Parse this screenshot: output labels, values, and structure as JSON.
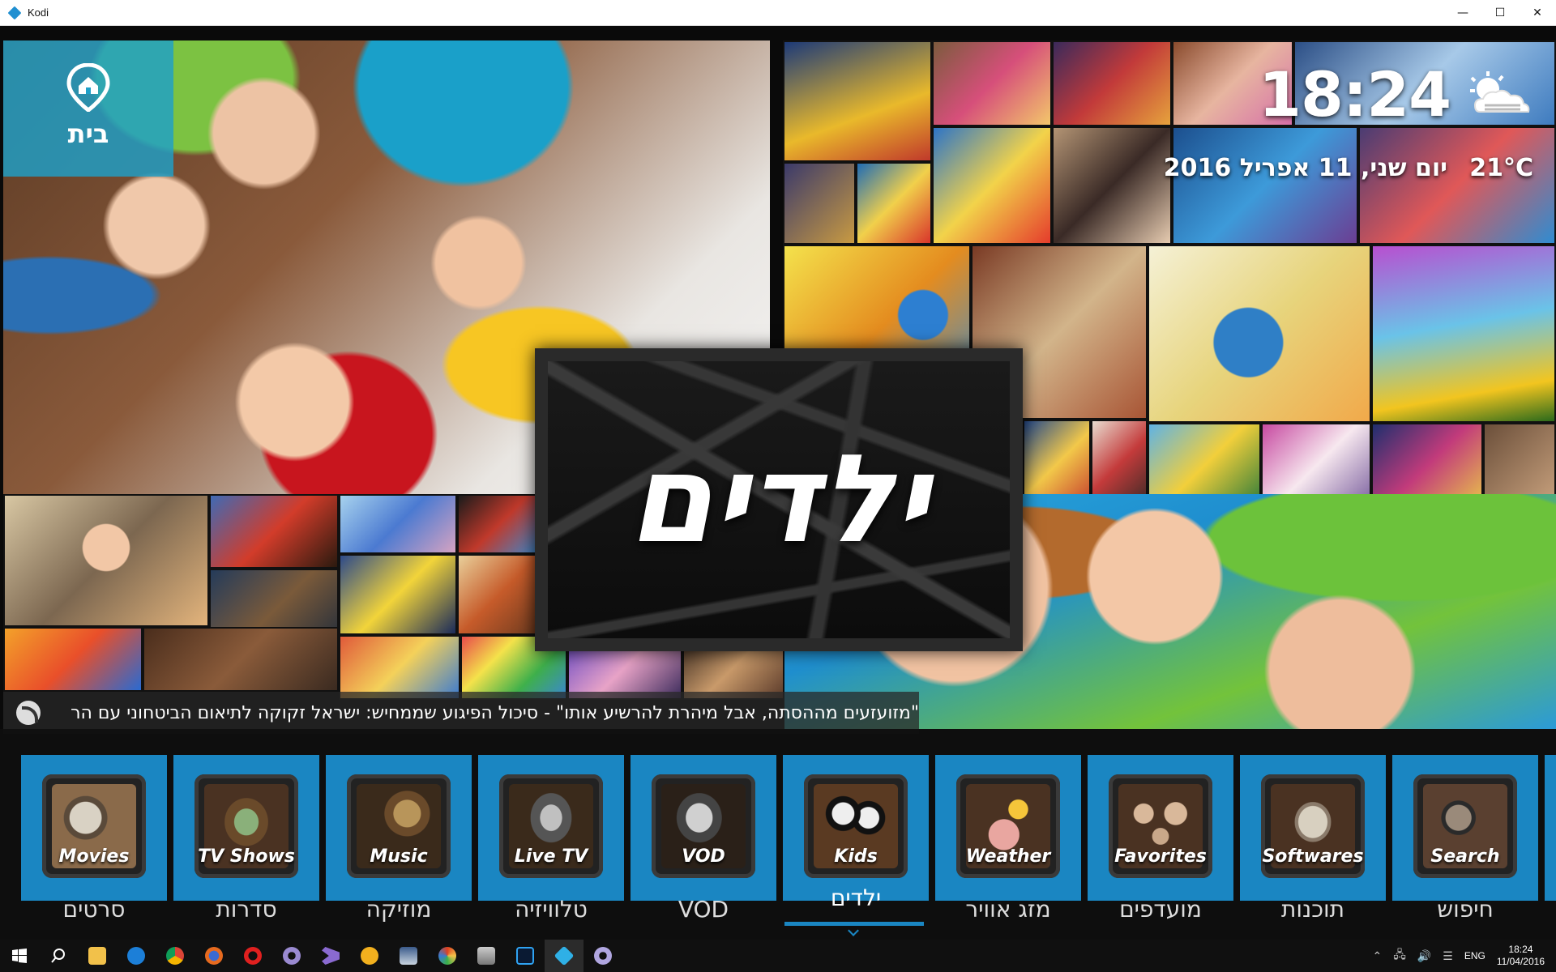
{
  "window": {
    "title": "Kodi",
    "minimize": "—",
    "maximize": "☐",
    "close": "✕"
  },
  "home": {
    "label": "בית",
    "icon": "home-icon"
  },
  "clock": {
    "time": "18:24",
    "date": "יום שני, 11 אפריל 2016",
    "temperature": "21°C",
    "weather_icon": "partly-cloudy-icon"
  },
  "section_title": "ילדים",
  "ticker": {
    "icon": "rss-icon",
    "text": "\"מזועזעים מההסתה, אבל מיהרת להרשיע אותו\" - סיכול הפיגוע שממחיש: ישראל זקוקה לתיאום הביטחוני עם הר"
  },
  "menu": {
    "items": [
      {
        "tile": "Movies",
        "label": "סרטים",
        "icon": "film-reel-icon"
      },
      {
        "tile": "TV Shows",
        "label": "סדרות",
        "icon": "retro-tv-icon"
      },
      {
        "tile": "Music",
        "label": "מוזיקה",
        "icon": "gramophone-icon"
      },
      {
        "tile": "Live TV",
        "label": "טלוויזיה",
        "icon": "live-tv-icon"
      },
      {
        "tile": "VOD",
        "label": "VOD",
        "icon": "vod-tv-icon"
      },
      {
        "tile": "Kids",
        "label": "ילדים",
        "icon": "cartoon-icon"
      },
      {
        "tile": "Weather",
        "label": "מזג אוויר",
        "icon": "weather-icon"
      },
      {
        "tile": "Favorites",
        "label": "מועדפים",
        "icon": "stars-icon"
      },
      {
        "tile": "Softwares",
        "label": "תוכנות",
        "icon": "computer-icon"
      },
      {
        "tile": "Search",
        "label": "חיפוש",
        "icon": "magnifier-icon"
      }
    ],
    "active_index": 5
  },
  "taskbar": {
    "icons": [
      "windows-start-icon",
      "search-icon",
      "file-explorer-icon",
      "edge-icon",
      "chrome-icon",
      "firefox-icon",
      "opera-icon",
      "app-swirl-icon",
      "visual-studio-icon",
      "app-triangle-icon",
      "app-window-icon",
      "app-circle-icon",
      "app-scanner-icon",
      "photoshop-icon",
      "kodi-icon",
      "app-swirl2-icon"
    ],
    "lang": "ENG",
    "time": "18:24",
    "date": "11/04/2016"
  },
  "colors": {
    "accent": "#1a86c2",
    "home_panel": "#1fa0c8"
  }
}
